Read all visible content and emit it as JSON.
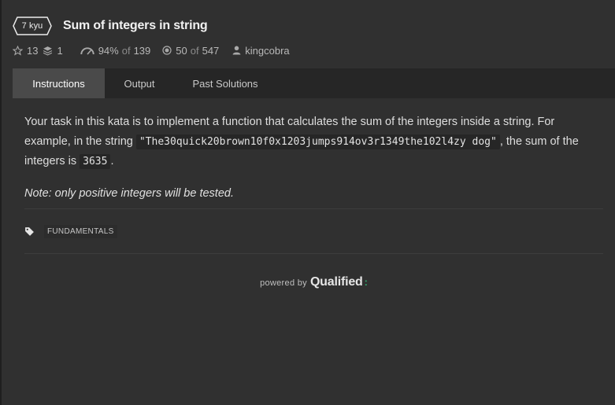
{
  "kata": {
    "rank": "7 kyu",
    "title": "Sum of integers in string"
  },
  "stats": {
    "stars": "13",
    "collections": "1",
    "satisfaction": "94%",
    "satisfaction_of": "of",
    "satisfaction_votes": "139",
    "completed": "50",
    "completed_of": "of",
    "completed_total": "547",
    "author": "kingcobra"
  },
  "tabs": {
    "instructions": "Instructions",
    "output": "Output",
    "past_solutions": "Past Solutions",
    "active": "Instructions"
  },
  "description": {
    "line_1": "Your task in this kata is to implement a function that calculates the sum of the integers inside a string. For example, in the string",
    "example_string": "\"The30quick20brown10f0x1203jumps914ov3r1349the102l4zy dog\"",
    "line_2": ", the sum of the integers is",
    "result": "3635",
    "line_end": ".",
    "note": "Note: only positive integers will be tested."
  },
  "tags": [
    "FUNDAMENTALS"
  ],
  "footer": {
    "powered_by": "powered by",
    "brand": "Qualified",
    "brand_mark": ":"
  },
  "colors": {
    "background": "#303030",
    "tab_active": "#4a4a4a",
    "tab_bar": "#262626",
    "brand_accent": "#2fa36a"
  }
}
